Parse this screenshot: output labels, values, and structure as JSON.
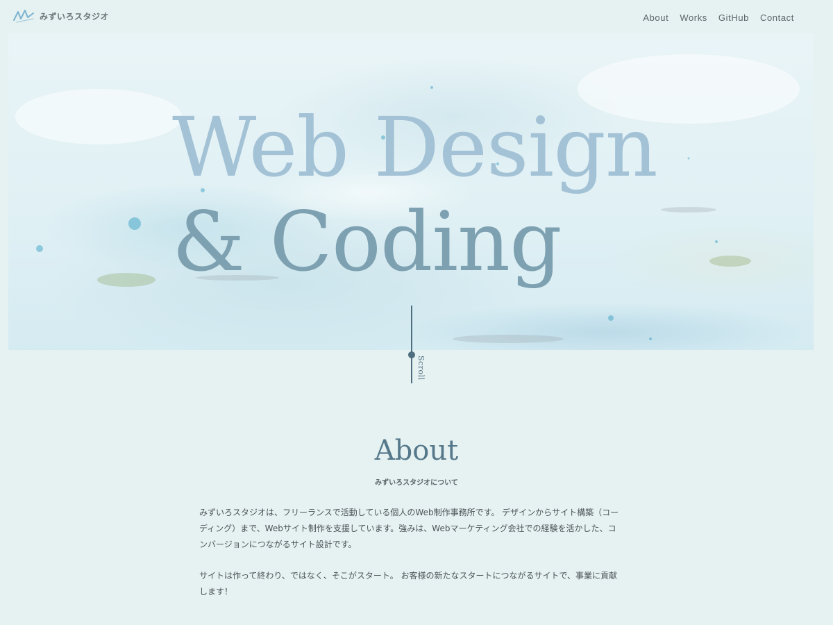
{
  "header": {
    "logo_text": "みずいろスタジオ",
    "nav": [
      {
        "label": "About"
      },
      {
        "label": "Works"
      },
      {
        "label": "GitHub"
      },
      {
        "label": "Contact"
      }
    ]
  },
  "hero": {
    "line1": "Web Design",
    "line2": "& Coding",
    "scroll_label": "Scroll"
  },
  "about": {
    "heading": "About",
    "subheading": "みずいろスタジオについて",
    "paragraph1": "みずいろスタジオは、フリーランスで活動している個人のWeb制作事務所です。 デザインからサイト構築（コーディング）まで、Webサイト制作を支援しています。強みは、Webマーケティング会社での経験を活かした、コンバージョンにつながるサイト設計です。",
    "paragraph2": "サイトは作って終わり、ではなく、そこがスタート。 お客様の新たなスタートにつながるサイトで、事業に貢献します！"
  },
  "colors": {
    "background": "#e6f1f1",
    "accent": "#55788a",
    "hero_title_top": "#a3c2d6",
    "hero_title_bottom": "#7ea1b2"
  }
}
